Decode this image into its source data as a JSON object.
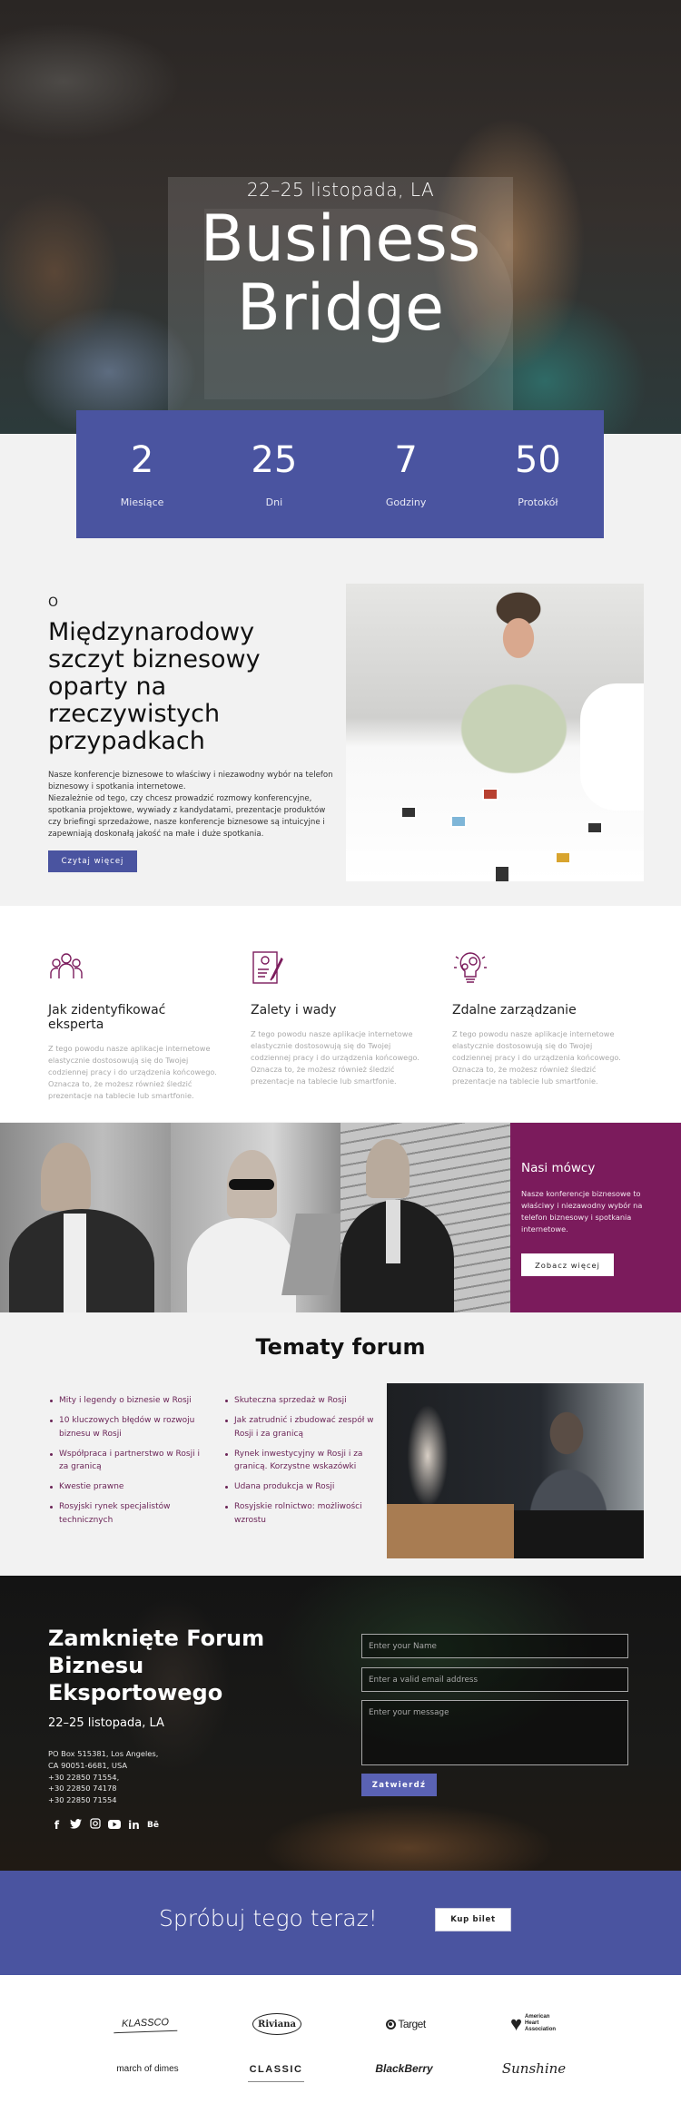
{
  "hero": {
    "date": "22–25 listopada, LA",
    "title_line1": "Business",
    "title_line2": "Bridge"
  },
  "countdown": [
    {
      "value": "2",
      "label": "Miesiące"
    },
    {
      "value": "25",
      "label": "Dni"
    },
    {
      "value": "7",
      "label": "Godziny"
    },
    {
      "value": "50",
      "label": "Protokół"
    }
  ],
  "about": {
    "eyebrow": "O",
    "title": "Międzynarodowy szczyt biznesowy oparty na rzeczywistych przypadkach",
    "paragraph1": "Nasze konferencje biznesowe to właściwy i niezawodny wybór na telefon biznesowy i spotkania internetowe.",
    "paragraph2": "Niezależnie od tego, czy chcesz prowadzić rozmowy konferencyjne, spotkania projektowe, wywiady z kandydatami, prezentacje produktów czy briefingi sprzedażowe, nasze konferencje biznesowe są intuicyjne i zapewniają doskonałą jakość na małe i duże spotkania.",
    "button": "Czytaj więcej"
  },
  "features": [
    {
      "icon": "team-icon",
      "title": "Jak zidentyfikować eksperta",
      "text": "Z tego powodu nasze aplikacje internetowe elastycznie dostosowują się do Twojej codziennej pracy i do urządzenia końcowego. Oznacza to, że możesz również śledzić prezentacje na tablecie lub smartfonie."
    },
    {
      "icon": "resume-icon",
      "title": "Zalety i wady",
      "text": "Z tego powodu nasze aplikacje internetowe elastycznie dostosowują się do Twojej codziennej pracy i do urządzenia końcowego. Oznacza to, że możesz również śledzić prezentacje na tablecie lub smartfonie."
    },
    {
      "icon": "lightbulb-gears-icon",
      "title": "Zdalne zarządzanie",
      "text": "Z tego powodu nasze aplikacje internetowe elastycznie dostosowują się do Twojej codziennej pracy i do urządzenia końcowego. Oznacza to, że możesz również śledzić prezentacje na tablecie lub smartfonie."
    }
  ],
  "speakers": {
    "title": "Nasi mówcy",
    "text": "Nasze konferencje biznesowe to właściwy i niezawodny wybór na telefon biznesowy i spotkania internetowe.",
    "button": "Zobacz więcej"
  },
  "topics": {
    "title": "Tematy forum",
    "column1": [
      "Mity i legendy o biznesie w Rosji",
      "10 kluczowych błędów w rozwoju biznesu w Rosji",
      "Współpraca i partnerstwo w Rosji i za granicą",
      "Kwestie prawne",
      "Rosyjski rynek specjalistów technicznych"
    ],
    "column2": [
      "Skuteczna sprzedaż w Rosji",
      "Jak zatrudnić i zbudować zespół w Rosji i za granicą",
      "Rynek inwestycyjny w Rosji i za granicą. Korzystne wskazówki",
      "Udana produkcja w Rosji",
      "Rosyjskie rolnictwo: możliwości wzrostu"
    ]
  },
  "contact": {
    "title": "Zamknięte Forum Biznesu Eksportowego",
    "date": "22–25 listopada, LA",
    "address_lines": [
      "PO Box 515381, Los Angeles,",
      "CA 90051-6681, USA",
      "+30 22850 71554,",
      "+30 22850 74178",
      "+30 22850 71554"
    ],
    "social": [
      {
        "name": "facebook-icon",
        "glyph": "f"
      },
      {
        "name": "twitter-icon",
        "glyph": "🐦"
      },
      {
        "name": "instagram-icon",
        "glyph": "◎"
      },
      {
        "name": "youtube-icon",
        "glyph": "▶"
      },
      {
        "name": "linkedin-icon",
        "glyph": "in"
      },
      {
        "name": "behance-icon",
        "glyph": "Bē"
      }
    ],
    "form": {
      "name_placeholder": "Enter your Name",
      "email_placeholder": "Enter a valid email address",
      "message_placeholder": "Enter your message",
      "submit": "Zatwierdź"
    }
  },
  "cta": {
    "text": "Spróbuj tego teraz!",
    "button": "Kup bilet"
  },
  "logos": [
    "KLASSCO",
    "Riviana",
    "Target",
    "American Heart Association",
    "march of dimes",
    "CLASSIC",
    "BlackBerry",
    "Sunshine"
  ]
}
